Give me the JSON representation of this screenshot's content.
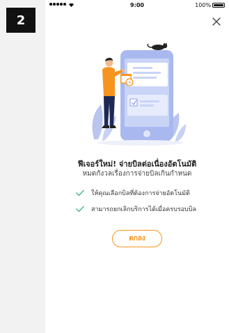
{
  "step": {
    "number": "2"
  },
  "status_bar": {
    "time": "9:00",
    "battery": "100%"
  },
  "icons": {
    "close": "close-icon",
    "check": "check-icon",
    "illustration": "autopay-illustration"
  },
  "colors": {
    "accent": "#f7941d",
    "check": "#4cbb7f",
    "illustration_blue": "#a9b9f0"
  },
  "content": {
    "title": "ฟีเจอร์ใหม่! จ่ายบิลต่อเนื่องอัตโนมัติ",
    "subtitle": "หมดกังวลเรื่องการจ่ายบิลเกินกำหนด",
    "benefits": [
      "ให้คุณเลือกบิลที่ต้องการจ่ายอัตโนมัติ",
      "สามารถยกเลิกบริการได้เมื่อครบรอบบิล"
    ],
    "ok_label": "ตกลง"
  }
}
